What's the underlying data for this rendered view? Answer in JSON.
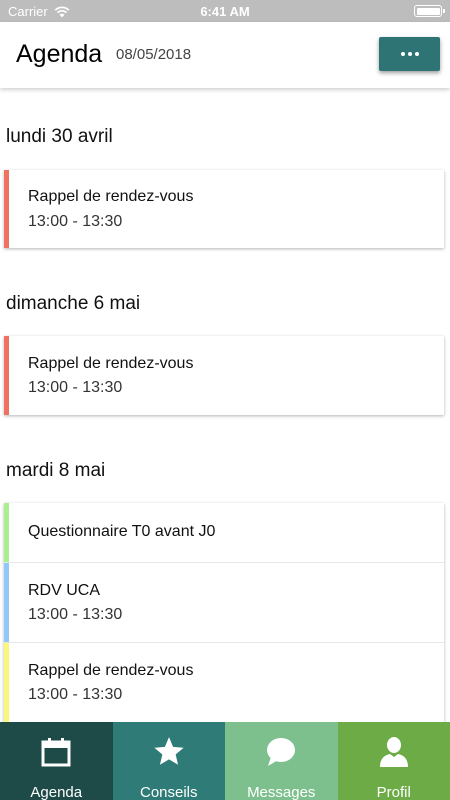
{
  "status_bar": {
    "carrier": "Carrier",
    "time": "6:41 AM"
  },
  "header": {
    "title": "Agenda",
    "date": "08/05/2018",
    "menu_icon": "ellipsis-icon"
  },
  "days": [
    {
      "label": "lundi 30 avril",
      "events": [
        {
          "title": "Rappel de rendez-vous",
          "time": "13:00 - 13:30",
          "color": "#f07062"
        }
      ]
    },
    {
      "label": "dimanche 6 mai",
      "events": [
        {
          "title": "Rappel de rendez-vous",
          "time": "13:00 - 13:30",
          "color": "#f07062"
        }
      ]
    },
    {
      "label": "mardi 8 mai",
      "events": [
        {
          "title": "Questionnaire T0 avant J0",
          "time": "",
          "color": "#a9ef91"
        },
        {
          "title": "RDV UCA",
          "time": "13:00 - 13:30",
          "color": "#90c9f7"
        },
        {
          "title": "Rappel de rendez-vous",
          "time": "13:00 - 13:30",
          "color": "#fbf77a"
        }
      ]
    }
  ],
  "tabs": [
    {
      "label": "Agenda",
      "icon": "calendar-icon",
      "color": "#1e4a47"
    },
    {
      "label": "Conseils",
      "icon": "star-icon",
      "color": "#2f7b78"
    },
    {
      "label": "Messages",
      "icon": "chat-bubble-icon",
      "color": "#7dc08d"
    },
    {
      "label": "Profil",
      "icon": "person-icon",
      "color": "#6cab45"
    }
  ]
}
